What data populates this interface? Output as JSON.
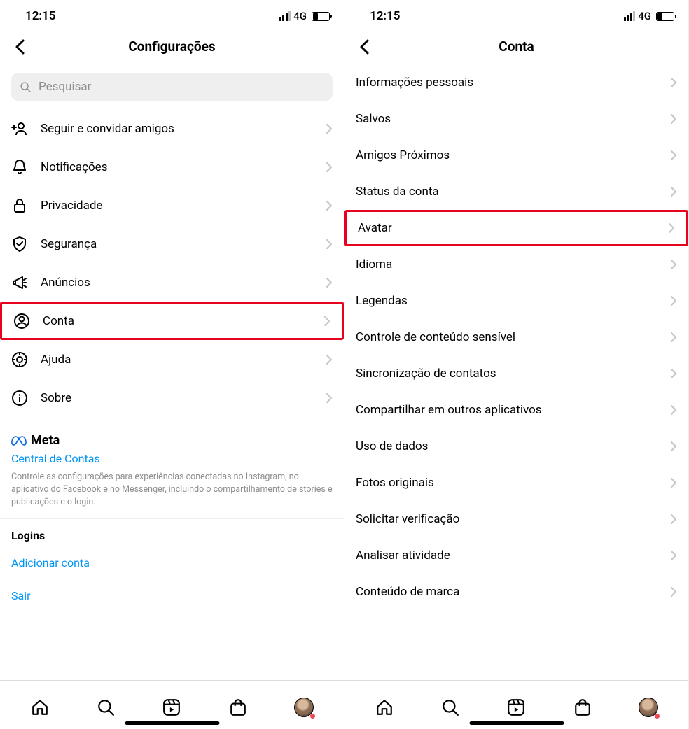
{
  "status": {
    "time": "12:15",
    "network": "4G"
  },
  "screen_left": {
    "title": "Configurações",
    "search_placeholder": "Pesquisar",
    "items": [
      {
        "label": "Seguir e convidar amigos",
        "icon": "add-person-icon"
      },
      {
        "label": "Notificações",
        "icon": "bell-icon"
      },
      {
        "label": "Privacidade",
        "icon": "lock-icon"
      },
      {
        "label": "Segurança",
        "icon": "shield-icon"
      },
      {
        "label": "Anúncios",
        "icon": "megaphone-icon"
      },
      {
        "label": "Conta",
        "icon": "account-icon",
        "highlight": true
      },
      {
        "label": "Ajuda",
        "icon": "help-icon"
      },
      {
        "label": "Sobre",
        "icon": "info-icon"
      }
    ],
    "meta_brand": "Meta",
    "accounts_center": "Central de Contas",
    "accounts_desc": "Controle as configurações para experiências conectadas no Instagram, no aplicativo do Facebook e no Messenger, incluindo o compartilhamento de stories e publicações e o login.",
    "logins_title": "Logins",
    "add_account": "Adicionar conta",
    "logout": "Sair"
  },
  "screen_right": {
    "title": "Conta",
    "items": [
      {
        "label": "Informações pessoais"
      },
      {
        "label": "Salvos"
      },
      {
        "label": "Amigos Próximos"
      },
      {
        "label": "Status da conta"
      },
      {
        "label": "Avatar",
        "highlight": true
      },
      {
        "label": "Idioma"
      },
      {
        "label": "Legendas"
      },
      {
        "label": "Controle de conteúdo sensível"
      },
      {
        "label": "Sincronização de contatos"
      },
      {
        "label": "Compartilhar em outros aplicativos"
      },
      {
        "label": "Uso de dados"
      },
      {
        "label": "Fotos originais"
      },
      {
        "label": "Solicitar verificação"
      },
      {
        "label": "Analisar atividade"
      },
      {
        "label": "Conteúdo de marca"
      }
    ]
  }
}
